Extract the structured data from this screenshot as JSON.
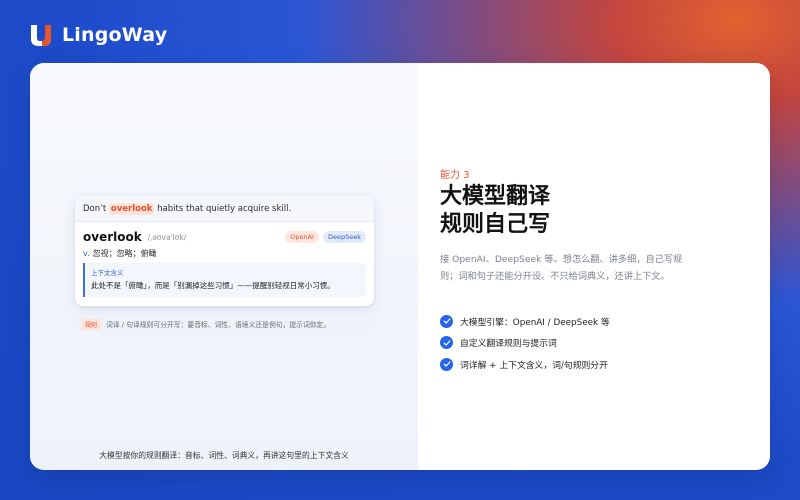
{
  "brand": {
    "name": "LingoWay"
  },
  "colors": {
    "accent": "#2563eb",
    "highlight": "#e2532c"
  },
  "card": {
    "sentence_before": "Don’t",
    "sentence_highlight": "overlook",
    "sentence_after": "habits that quietly acquire skill.",
    "word": "overlook",
    "phonetic": "/ˌəʊvəˈlʊk/",
    "tags": [
      "OpenAI",
      "DeepSeek"
    ],
    "pos": "v.",
    "definition": "忽视；忽略；俯瞰",
    "context_label": "上下文含义",
    "context_text": "此处不是「俯瞰」，而是「别漏掉这些习惯」——提醒别轻视日常小习惯。"
  },
  "rule": {
    "tag": "规则",
    "text": "词译 / 句译规则可分开写：要音标、词性、语境义还是例句，提示词你定。"
  },
  "caption": "大模型按你的规则翻译：音标、词性、词典义，再讲这句里的上下文含义",
  "right": {
    "kicker": "能力 3",
    "title_line1": "大模型翻译",
    "title_line2": "规则自己写",
    "description": "接 OpenAI、DeepSeek 等。想怎么翻、讲多细，自己写规则；词和句子还能分开设。不只给词典义，还讲上下文。",
    "features": [
      "大模型引擎：OpenAI / DeepSeek 等",
      "自定义翻译规则与提示词",
      "词详解 + 上下文含义，词/句规则分开"
    ]
  }
}
